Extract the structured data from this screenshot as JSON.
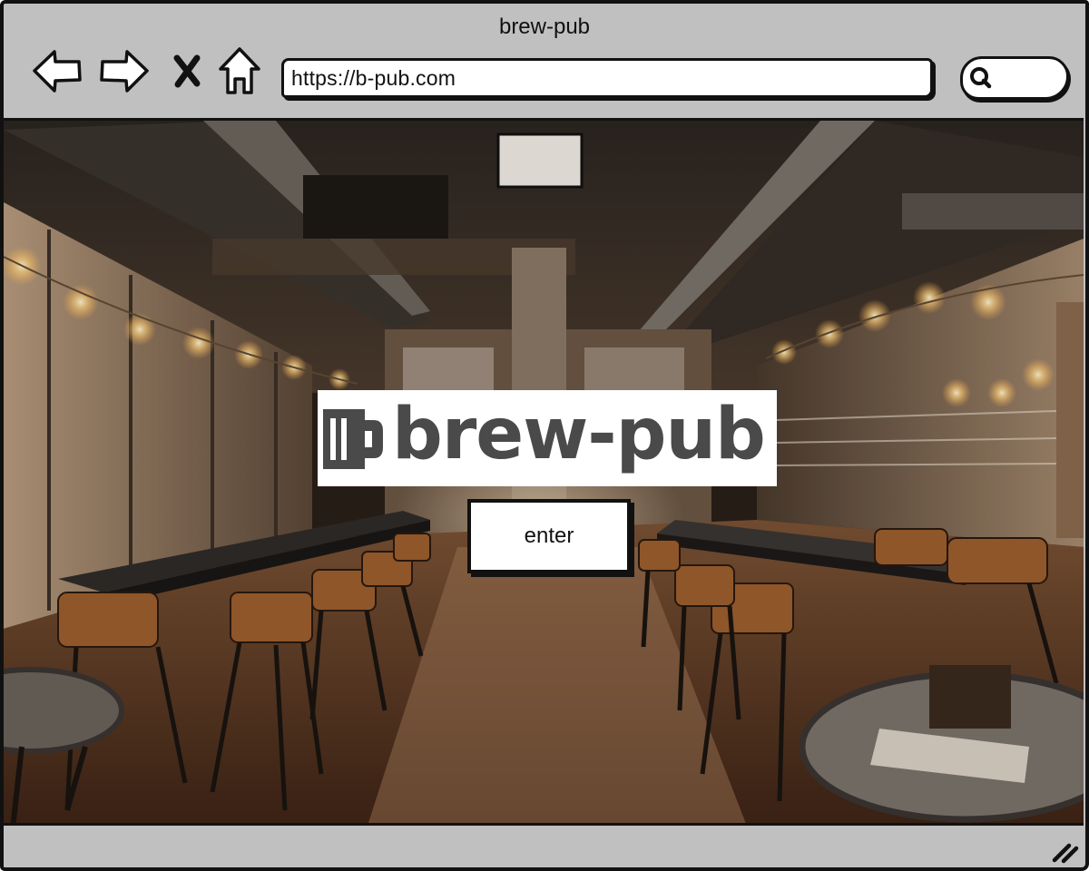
{
  "window": {
    "title": "brew-pub",
    "chrome_color": "#c0c0c0",
    "outline_color": "#111111"
  },
  "toolbar": {
    "back_icon": "back-arrow-icon",
    "forward_icon": "forward-arrow-icon",
    "stop_icon": "close-x-icon",
    "home_icon": "home-icon",
    "address_url": "https://b-pub.com",
    "search_icon": "search-icon"
  },
  "page": {
    "background_image": "brewpub-interior-photo",
    "logo": {
      "text": "brew-pub",
      "icon": "beer-mug-icon",
      "text_color": "#4a4a4a"
    },
    "enter_label": "enter"
  },
  "status_bar": {
    "resize_icon": "resize-grip-icon"
  }
}
